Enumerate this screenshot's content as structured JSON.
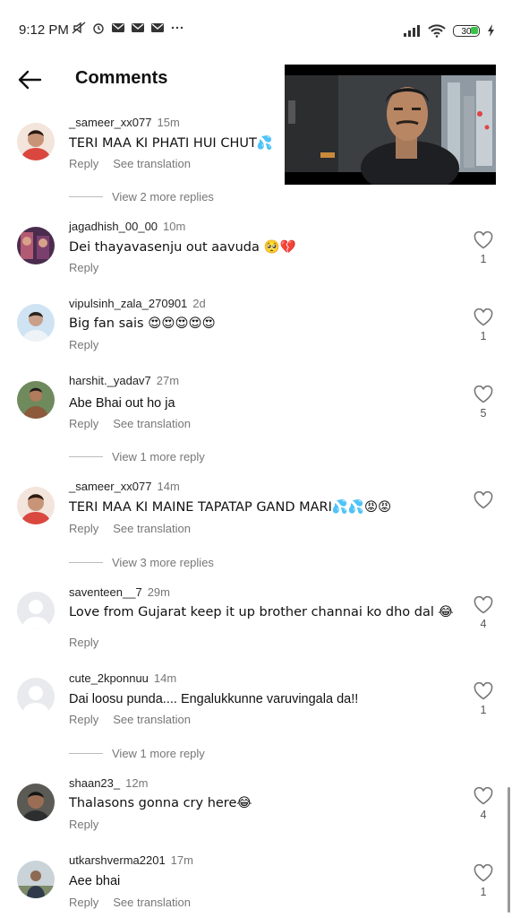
{
  "status": {
    "time": "9:12 PM",
    "battery": "30"
  },
  "header": {
    "title": "Comments"
  },
  "comments": [
    {
      "user": "_sameer_xx077",
      "time": "15m",
      "text": "TERI MAA KI PHATI HUI CHUT💦",
      "reply": "Reply",
      "translate": "See translation",
      "more": "View 2 more replies"
    },
    {
      "user": "jagadhish_00_00",
      "time": "10m",
      "text": "Dei thayavasenju out aavuda 🥺💔",
      "reply": "Reply",
      "likes": "1"
    },
    {
      "user": "vipulsinh_zala_270901",
      "time": "2d",
      "text": "Big fan sais 😍😍😍😍😍",
      "reply": "Reply",
      "likes": "1"
    },
    {
      "user": "harshit._yadav7",
      "time": "27m",
      "text": "Abe Bhai out ho ja",
      "reply": "Reply",
      "translate": "See translation",
      "likes": "5",
      "more": "View 1 more reply"
    },
    {
      "user": "_sameer_xx077",
      "time": "14m",
      "text": "TERI MAA KI MAINE TAPATAP GAND MARI💦💦😡😡",
      "reply": "Reply",
      "translate": "See translation",
      "more": "View 3 more replies"
    },
    {
      "user": "saventeen__7",
      "time": "29m",
      "text": "Love from Gujarat keep it up brother channai ko dho dal 😂",
      "reply": "Reply",
      "likes": "4"
    },
    {
      "user": "cute_2kponnuu",
      "time": "14m",
      "text": "Dai loosu punda.... Engalukkunne varuvingala da!!",
      "reply": "Reply",
      "translate": "See translation",
      "likes": "1",
      "more": "View 1 more reply"
    },
    {
      "user": "shaan23_",
      "time": "12m",
      "text": "Thalasons gonna cry here😂",
      "reply": "Reply",
      "likes": "4"
    },
    {
      "user": "utkarshverma2201",
      "time": "17m",
      "text": "Aee bhai",
      "reply": "Reply",
      "translate": "See translation",
      "likes": "1"
    }
  ]
}
